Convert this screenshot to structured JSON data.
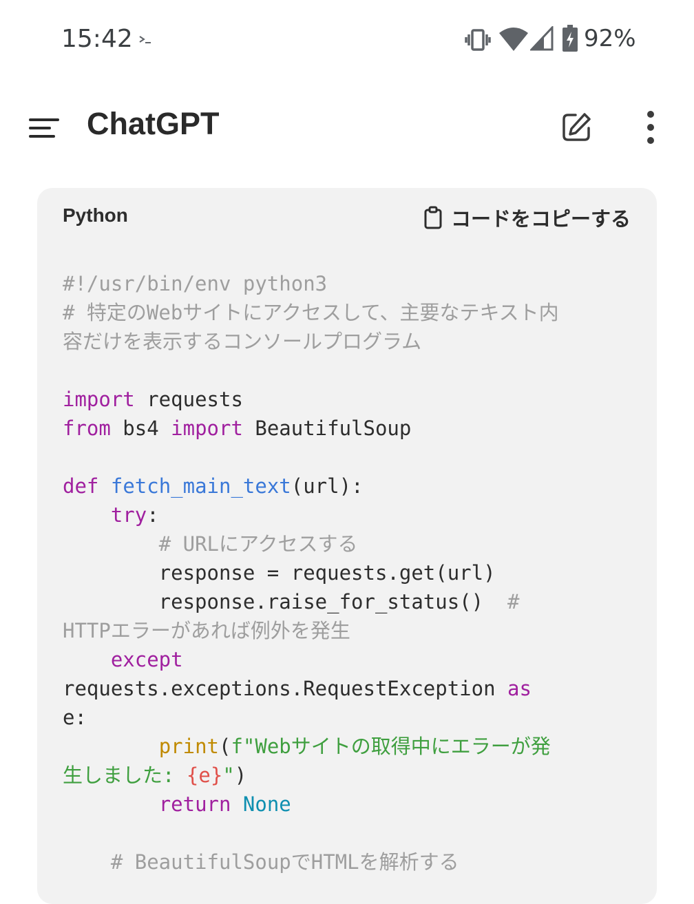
{
  "status_bar": {
    "time": "15:42",
    "battery_percent": "92%",
    "icons": [
      "terminal-icon",
      "vibrate-icon",
      "wifi-icon",
      "signal-icon",
      "battery-charging-icon"
    ]
  },
  "app_bar": {
    "title": "ChatGPT",
    "icons": [
      "menu-icon",
      "new-chat-edit-icon",
      "more-vert-icon"
    ]
  },
  "code_block": {
    "language": "Python",
    "copy_label": "コードをコピーする",
    "copy_icon": "clipboard-icon",
    "lines": [
      [
        {
          "t": "#!/usr/bin/env python3",
          "c": "c"
        }
      ],
      [
        {
          "t": "# 特定のWebサイトにアクセスして、主要なテキスト内",
          "c": "c"
        }
      ],
      [
        {
          "t": "容だけを表示するコンソールプログラム",
          "c": "c"
        }
      ],
      [],
      [
        {
          "t": "import",
          "c": "k"
        },
        {
          "t": " requests",
          "c": ""
        }
      ],
      [
        {
          "t": "from",
          "c": "k"
        },
        {
          "t": " bs4 ",
          "c": ""
        },
        {
          "t": "import",
          "c": "k"
        },
        {
          "t": " BeautifulSoup",
          "c": ""
        }
      ],
      [],
      [
        {
          "t": "def",
          "c": "k"
        },
        {
          "t": " ",
          "c": ""
        },
        {
          "t": "fetch_main_text",
          "c": "f"
        },
        {
          "t": "(url):",
          "c": ""
        }
      ],
      [
        {
          "t": "    ",
          "c": ""
        },
        {
          "t": "try",
          "c": "k"
        },
        {
          "t": ":",
          "c": ""
        }
      ],
      [
        {
          "t": "        ",
          "c": ""
        },
        {
          "t": "# URLにアクセスする",
          "c": "c"
        }
      ],
      [
        {
          "t": "        response = requests.get(url)",
          "c": ""
        }
      ],
      [
        {
          "t": "        response.raise_for_status()  ",
          "c": ""
        },
        {
          "t": "#",
          "c": "c"
        }
      ],
      [
        {
          "t": "HTTPエラーがあれば例外を発生",
          "c": "c"
        }
      ],
      [
        {
          "t": "    ",
          "c": ""
        },
        {
          "t": "except",
          "c": "k"
        }
      ],
      [
        {
          "t": "requests.exceptions.RequestException ",
          "c": ""
        },
        {
          "t": "as",
          "c": "k"
        }
      ],
      [
        {
          "t": "e:",
          "c": ""
        }
      ],
      [
        {
          "t": "        ",
          "c": ""
        },
        {
          "t": "print",
          "c": "b"
        },
        {
          "t": "(",
          "c": ""
        },
        {
          "t": "f\"Webサイトの取得中にエラーが発",
          "c": "s"
        }
      ],
      [
        {
          "t": "生しました: ",
          "c": "s"
        },
        {
          "t": "{e}",
          "c": "i"
        },
        {
          "t": "\"",
          "c": "s"
        },
        {
          "t": ")",
          "c": ""
        }
      ],
      [
        {
          "t": "        ",
          "c": ""
        },
        {
          "t": "return",
          "c": "k"
        },
        {
          "t": " ",
          "c": ""
        },
        {
          "t": "None",
          "c": "n"
        }
      ],
      [],
      [
        {
          "t": "    ",
          "c": ""
        },
        {
          "t": "# BeautifulSoupでHTMLを解析する",
          "c": "c"
        }
      ]
    ]
  },
  "colors": {
    "comment": "#9e9e9e",
    "keyword": "#a0209f",
    "function": "#3a78d8",
    "builtin": "#c08a00",
    "string": "#3f9f3f",
    "interpolation": "#e0504a",
    "constant": "#0f8fb0",
    "code_background": "#f2f2f2"
  }
}
